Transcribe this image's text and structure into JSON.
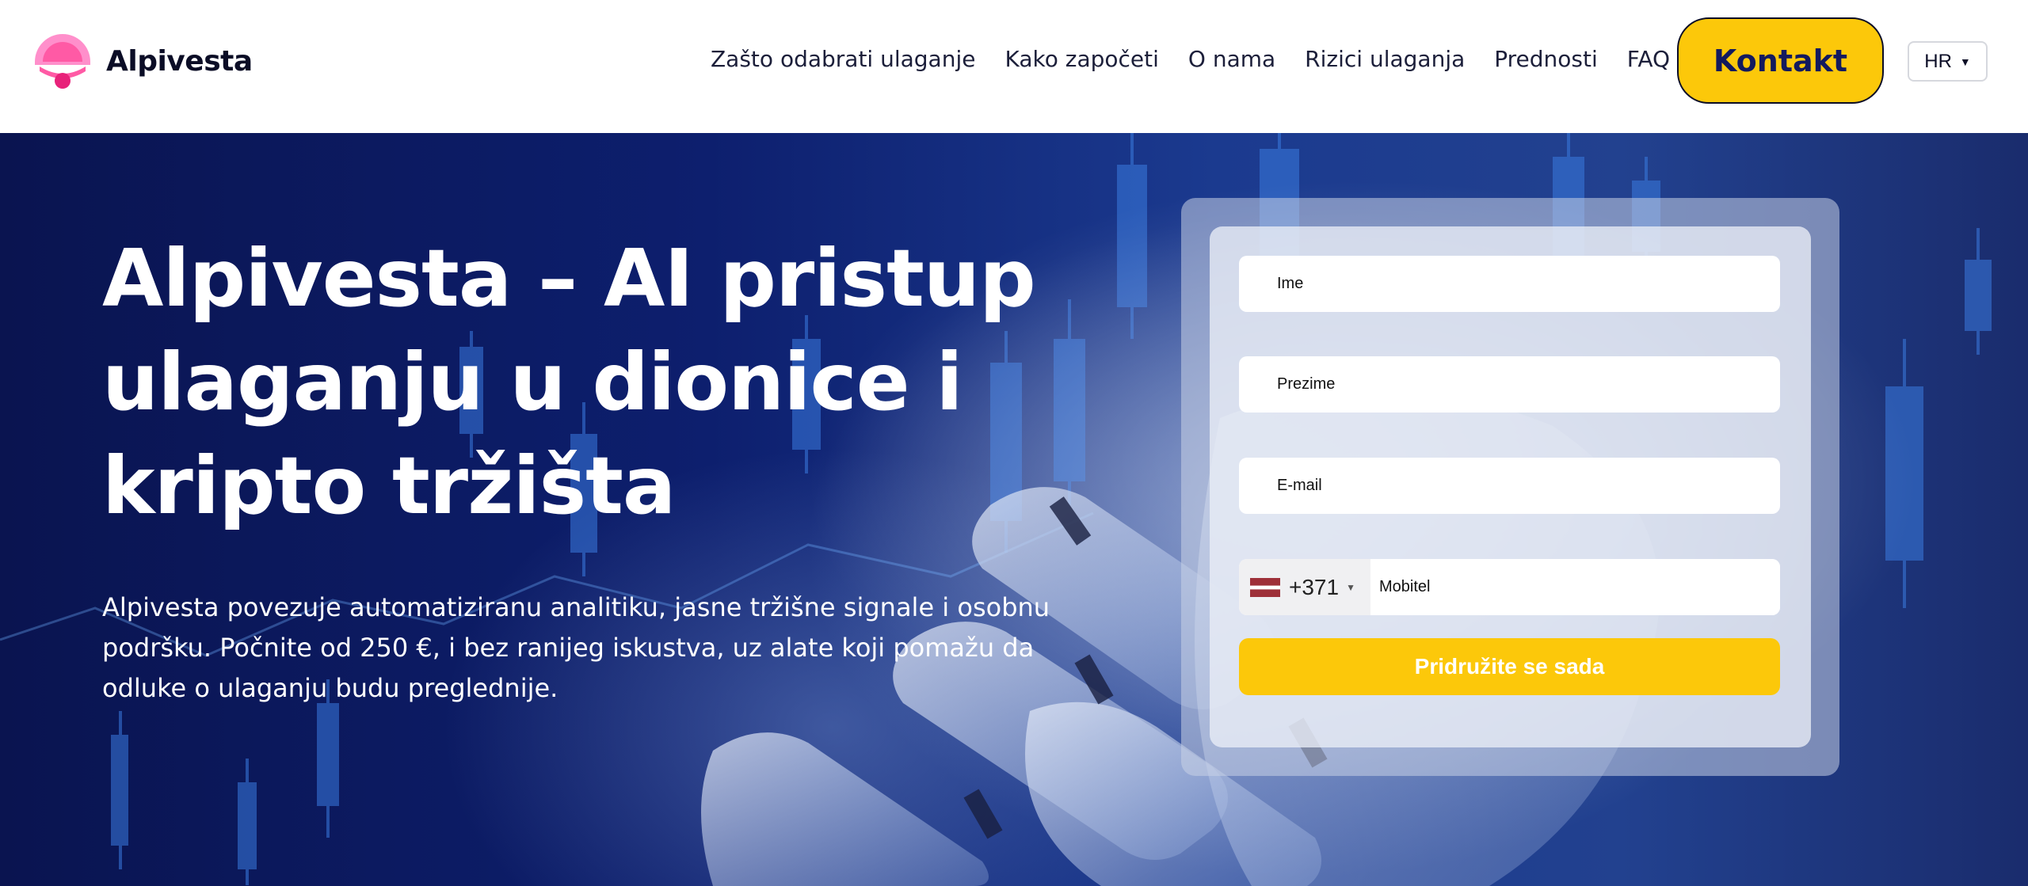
{
  "brand": {
    "name": "Alpivesta",
    "logo_icon": "parachute-dome-icon",
    "logo_colors": [
      "#ff5aa5",
      "#ff8fcb",
      "#e8227a"
    ]
  },
  "nav": {
    "items": [
      {
        "label": "Zašto odabrati ulaganje"
      },
      {
        "label": "Kako započeti"
      },
      {
        "label": "O nama"
      },
      {
        "label": "Rizici ulaganja"
      },
      {
        "label": "Prednosti"
      },
      {
        "label": "FAQ"
      }
    ],
    "cta_label": "Kontakt",
    "language": "HR"
  },
  "hero": {
    "title_lines": [
      "Alpivesta – AI pristup",
      "ulaganju u dionice i",
      "kripto tržišta"
    ],
    "description": "Alpivesta povezuje automatiziranu analitiku, jasne tržišne signale i osobnu podršku. Počnite od 250 €, i bez ranijeg iskustva, uz alate koji pomažu da odluke o ulaganju budu preglednije."
  },
  "form": {
    "first_name_placeholder": "Ime",
    "last_name_placeholder": "Prezime",
    "email_placeholder": "E-mail",
    "phone": {
      "dial_code": "+371",
      "flag": "latvia-flag-icon",
      "placeholder": "Mobitel"
    },
    "submit_label": "Pridružite se sada"
  },
  "colors": {
    "accent": "#fcc80a",
    "dark_navy": "#0b0d26",
    "hero_bg": "#0d1f6e"
  }
}
